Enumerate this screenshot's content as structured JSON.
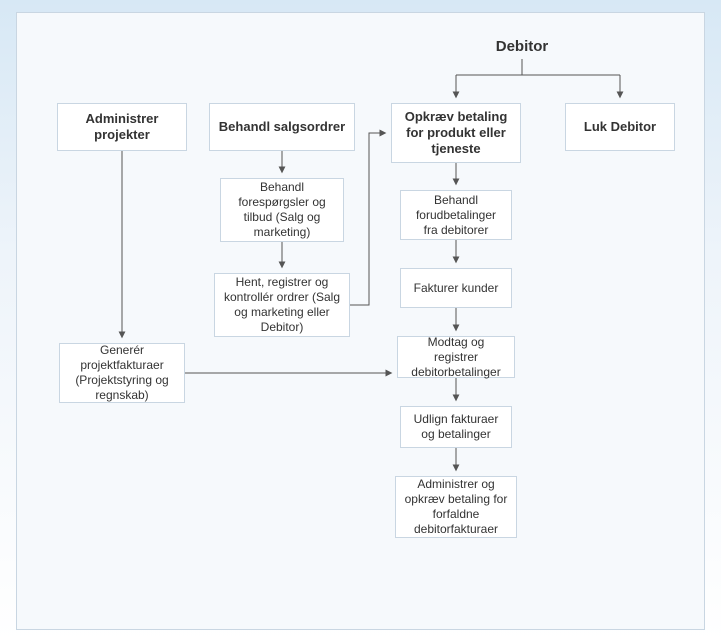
{
  "title": "Debitor",
  "headers": {
    "administer_projects": "Administrer projekter",
    "process_sales_orders": "Behandl salgsordrer",
    "collect_payment": "Opkræv betaling for produkt eller tjeneste",
    "close_ar": "Luk Debitor"
  },
  "nodes": {
    "handle_inquiries": "Behandl forespørgsler og tilbud (Salg og marketing)",
    "fetch_register_orders": "Hent, registrer og kontrollér ordrer (Salg og marketing eller Debitor)",
    "generate_project_invoices": "Generér projektfakturaer (Projektstyring og regnskab)",
    "process_prepayments": "Behandl forudbetalinger fra debitorer",
    "invoice_customers": "Fakturer kunder",
    "receive_register_payments": "Modtag og registrer debitorbetalinger",
    "settle_invoices_payments": "Udlign fakturaer og betalinger",
    "manage_collect_overdue": "Administrer og opkræv betaling for forfaldne debitorfakturaer"
  }
}
